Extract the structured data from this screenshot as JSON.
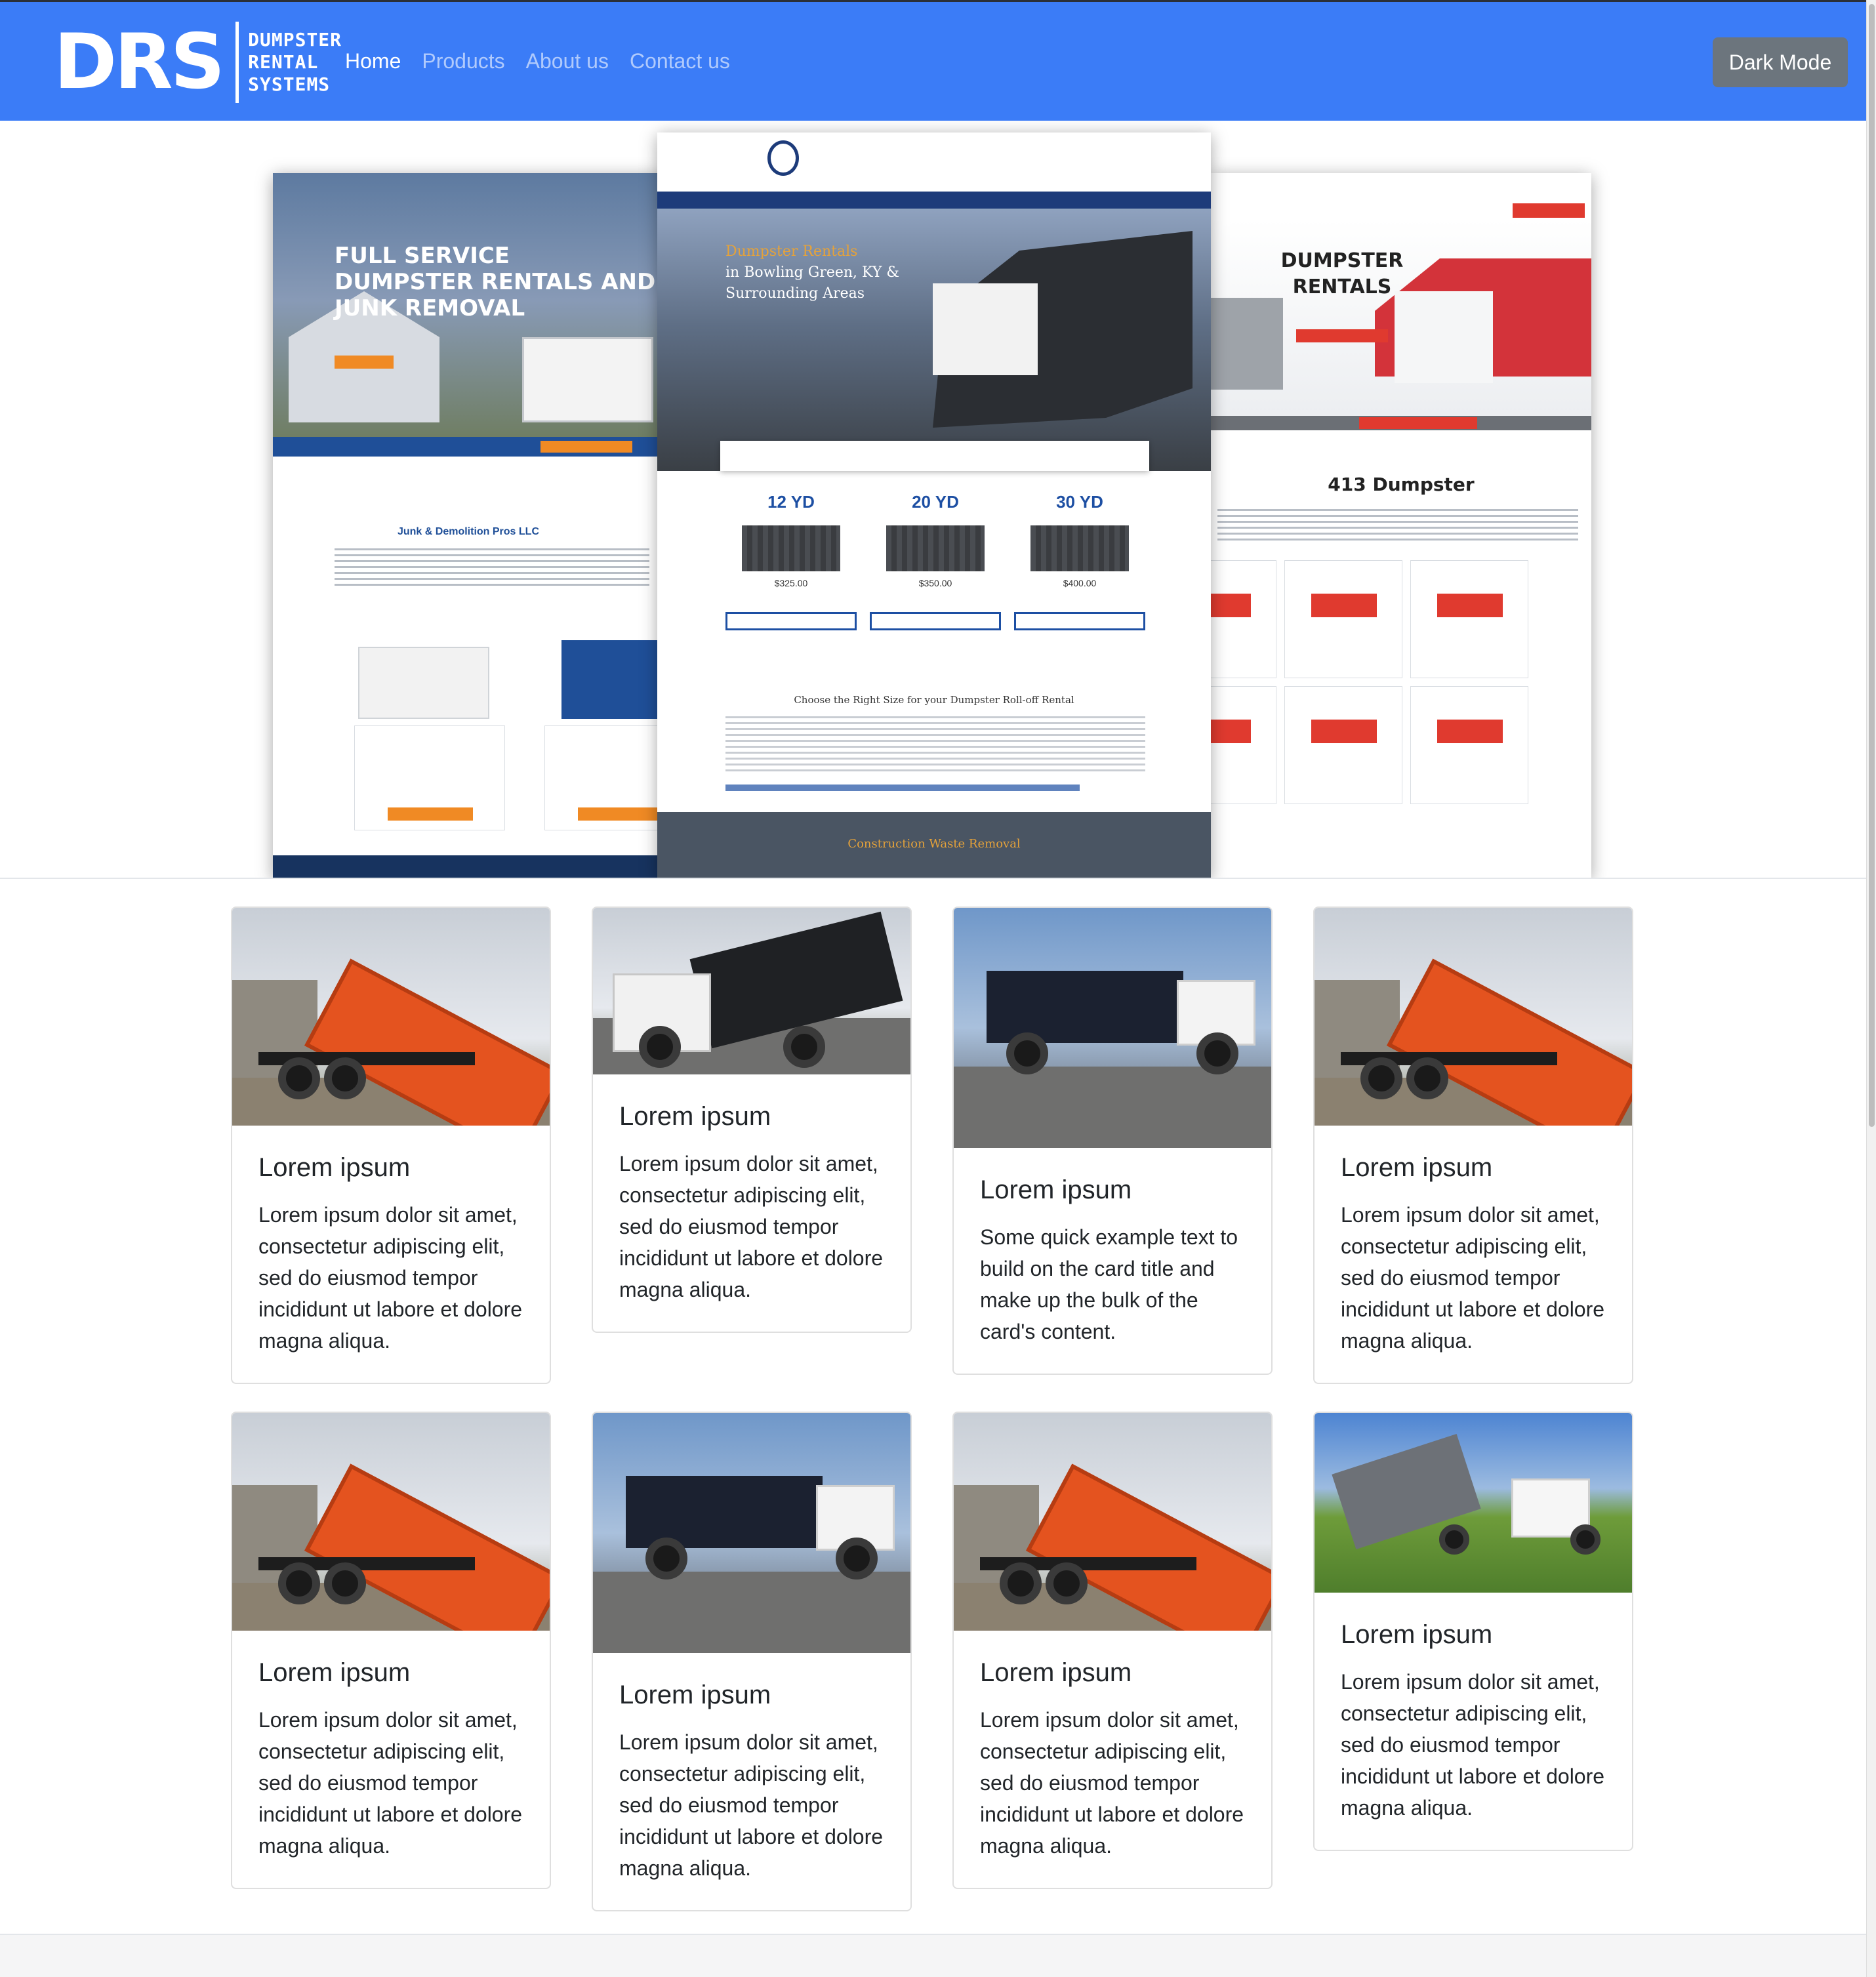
{
  "navbar": {
    "logo_letters": "DRS",
    "logo_line1": "DUMPSTER",
    "logo_line2": "RENTAL",
    "logo_line3": "SYSTEMS",
    "links": [
      "Home",
      "Products",
      "About us",
      "Contact us"
    ],
    "active_link": "Home",
    "dark_mode_label": "Dark Mode",
    "bg_color": "#3b7cf7"
  },
  "hero": {
    "left": {
      "headline": "FULL SERVICE DUMPSTER RENTALS AND JUNK REMOVAL",
      "company": "Junk & Demolition Pros LLC"
    },
    "middle": {
      "headline_accent": "Dumpster Rentals",
      "headline_rest": "in Bowling Green, KY & Surrounding Areas",
      "sizes": [
        {
          "label": "12 YD",
          "price": "$325.00"
        },
        {
          "label": "20 YD",
          "price": "$350.00"
        },
        {
          "label": "30 YD",
          "price": "$400.00"
        }
      ],
      "choose_text": "Choose the Right Size for your Dumpster Roll-off Rental",
      "footer_text": "Construction Waste Removal"
    },
    "right": {
      "headline": "DUMPSTER RENTALS",
      "title": "413 Dumpster"
    }
  },
  "cards": [
    {
      "title": "Lorem ipsum",
      "text": "Lorem ipsum dolor sit amet, consectetur adipiscing elit, sed do eiusmod tempor incididunt ut labore et dolore magna aliqua.",
      "image": "orange-dumpster-trailer-photo"
    },
    {
      "title": "Lorem ipsum",
      "text": "Lorem ipsum dolor sit amet, consectetur adipiscing elit, sed do eiusmod tempor incididunt ut labore et dolore magna aliqua.",
      "image": "white-truck-black-dumpster-photo"
    },
    {
      "title": "Lorem ipsum",
      "text": "Some quick example text to build on the card title and make up the bulk of the card's content.",
      "image": "rolloff-truck-parking-lot-photo"
    },
    {
      "title": "Lorem ipsum",
      "text": "Lorem ipsum dolor sit amet, consectetur adipiscing elit, sed do eiusmod tempor incididunt ut labore et dolore magna aliqua.",
      "image": "orange-dumpster-trailer-photo"
    },
    {
      "title": "Lorem ipsum",
      "text": "Lorem ipsum dolor sit amet, consectetur adipiscing elit, sed do eiusmod tempor incididunt ut labore et dolore magna aliqua.",
      "image": "orange-dumpster-trailer-photo"
    },
    {
      "title": "Lorem ipsum",
      "text": "Lorem ipsum dolor sit amet, consectetur adipiscing elit, sed do eiusmod tempor incididunt ut labore et dolore magna aliqua.",
      "image": "rolloff-truck-parking-lot-photo"
    },
    {
      "title": "Lorem ipsum",
      "text": "Lorem ipsum dolor sit amet, consectetur adipiscing elit, sed do eiusmod tempor incididunt ut labore et dolore magna aliqua.",
      "image": "orange-dumpster-trailer-photo"
    },
    {
      "title": "Lorem ipsum",
      "text": "Lorem ipsum dolor sit amet, consectetur adipiscing elit, sed do eiusmod tempor incididunt ut labore et dolore magna aliqua.",
      "image": "hooklift-truck-field-photo"
    }
  ]
}
